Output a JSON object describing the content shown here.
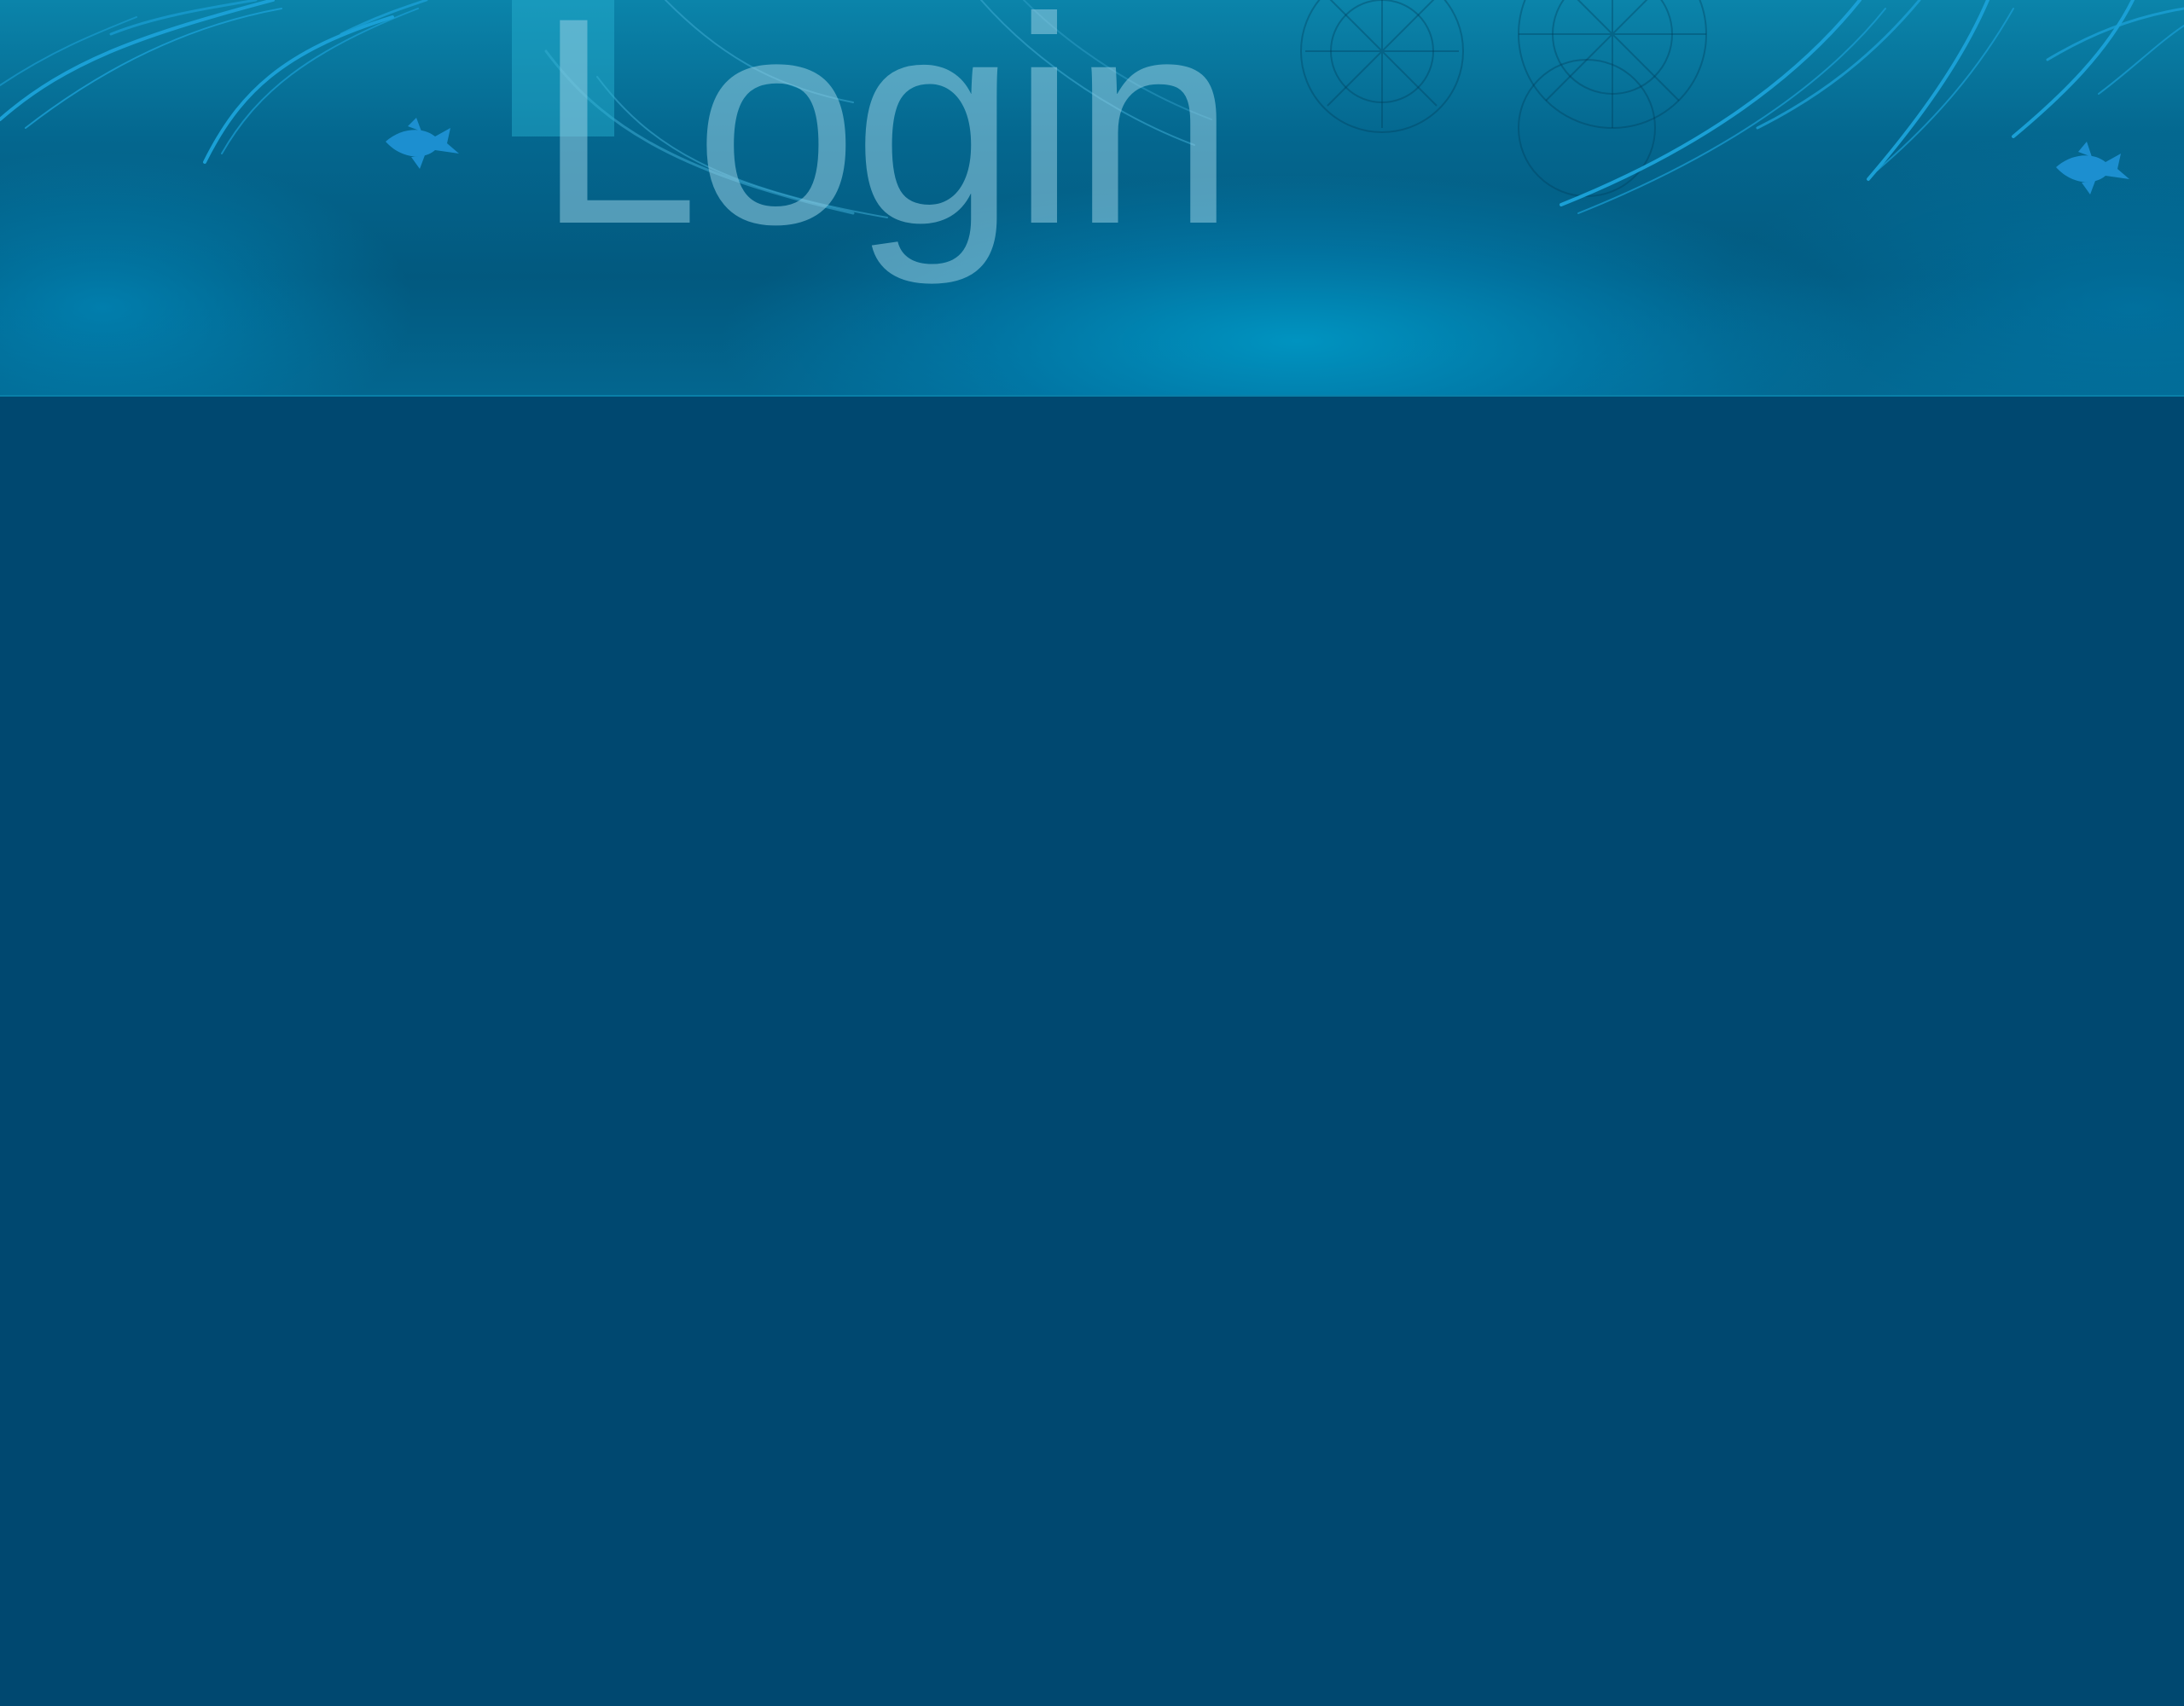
{
  "header": {
    "title": "Login"
  },
  "colors": {
    "background": "#004870",
    "banner_light": "#0096c3",
    "banner_dark": "#02597f",
    "title_text": "#96cde1",
    "swirl": "#1aa0d6"
  },
  "icons": {
    "left_fish": "fish-icon",
    "right_fish": "fish-icon"
  }
}
